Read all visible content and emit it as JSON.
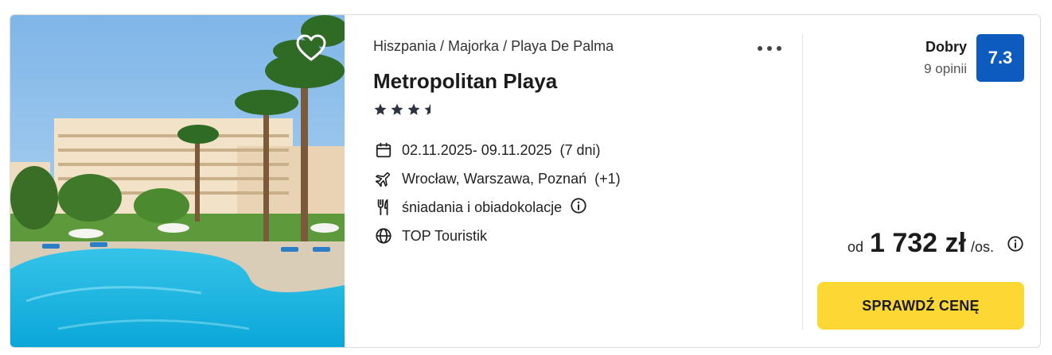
{
  "hotel": {
    "breadcrumb": "Hiszpania / Majorka / Playa De Palma",
    "name": "Metropolitan Playa",
    "stars": 3.5,
    "dates": "02.11.2025- 09.11.2025",
    "duration": "(7 dni)",
    "departures": "Wrocław, Warszawa, Poznań",
    "departures_extra": "(+1)",
    "board": "śniadania i obiadokolacje",
    "operator": "TOP Touristik"
  },
  "rating": {
    "label": "Dobry",
    "count": "9 opinii",
    "score": "7.3"
  },
  "price": {
    "prefix": "od",
    "amount": "1 732 zł",
    "suffix": "/os."
  },
  "cta": {
    "label": "SPRAWDŹ CENĘ"
  },
  "icons": {
    "favorite": "heart-icon",
    "more": "more-dots-icon",
    "date": "calendar-icon",
    "departure": "plane-icon",
    "board": "cutlery-icon",
    "operator": "globe-icon",
    "info": "info-icon"
  },
  "colors": {
    "badge": "#0e5bbf",
    "cta": "#fdd835",
    "stars": "#2d3440"
  }
}
